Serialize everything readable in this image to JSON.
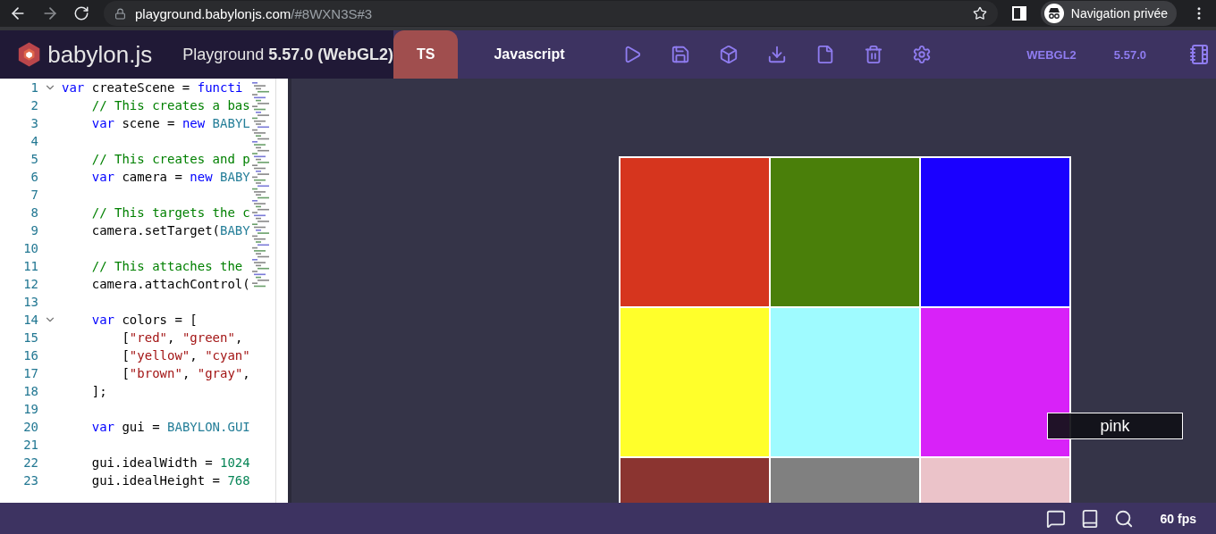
{
  "browser": {
    "url_host": "playground.babylonjs.com",
    "url_path": "/#8WXN3S#3",
    "profile_label": "Navigation privée"
  },
  "header": {
    "logo_text": "babylon.js",
    "title": "Playground **5.57.0 (WebGL2)**",
    "tabs": [
      {
        "label": "TS",
        "selected": true
      },
      {
        "label": "Javascript",
        "selected": false
      }
    ],
    "engine": "WEBGL2",
    "version": "5.57.0"
  },
  "editor": {
    "lines": [
      {
        "number": "1",
        "foldable": true,
        "segments": [
          {
            "kind": "keyword",
            "text": "var"
          },
          {
            "kind": "plain",
            "text": " createScene = "
          },
          {
            "kind": "keyword",
            "text": "functi"
          }
        ]
      },
      {
        "number": "2",
        "foldable": false,
        "segments": [
          {
            "kind": "comment",
            "text": "    // This creates a bas"
          }
        ]
      },
      {
        "number": "3",
        "foldable": false,
        "segments": [
          {
            "kind": "keyword",
            "text": "    var"
          },
          {
            "kind": "plain",
            "text": " scene = "
          },
          {
            "kind": "keyword",
            "text": "new"
          },
          {
            "kind": "ident",
            "text": " BABYL"
          }
        ]
      },
      {
        "number": "4",
        "foldable": false
      },
      {
        "number": "5",
        "foldable": false,
        "segments": [
          {
            "kind": "comment",
            "text": "    // This creates and p"
          }
        ]
      },
      {
        "number": "6",
        "foldable": false,
        "segments": [
          {
            "kind": "keyword",
            "text": "    var"
          },
          {
            "kind": "plain",
            "text": " camera = "
          },
          {
            "kind": "keyword",
            "text": "new"
          },
          {
            "kind": "ident",
            "text": " BABY"
          }
        ]
      },
      {
        "number": "7",
        "foldable": false
      },
      {
        "number": "8",
        "foldable": false,
        "segments": [
          {
            "kind": "comment",
            "text": "    // This targets the c"
          }
        ]
      },
      {
        "number": "9",
        "foldable": false,
        "segments": [
          {
            "kind": "plain",
            "text": "    camera.setTarget("
          },
          {
            "kind": "ident",
            "text": "BABY"
          }
        ]
      },
      {
        "number": "10",
        "foldable": false
      },
      {
        "number": "11",
        "foldable": false,
        "segments": [
          {
            "kind": "comment",
            "text": "    // This attaches the"
          }
        ]
      },
      {
        "number": "12",
        "foldable": false,
        "segments": [
          {
            "kind": "plain",
            "text": "    camera.attachControl("
          }
        ]
      },
      {
        "number": "13",
        "foldable": false
      },
      {
        "number": "14",
        "foldable": true,
        "segments": [
          {
            "kind": "keyword",
            "text": "    var"
          },
          {
            "kind": "plain",
            "text": " colors = ["
          }
        ]
      },
      {
        "number": "15",
        "foldable": false,
        "segments": [
          {
            "kind": "plain",
            "text": "        ["
          },
          {
            "kind": "string",
            "text": "\"red\""
          },
          {
            "kind": "plain",
            "text": ", "
          },
          {
            "kind": "string",
            "text": "\"green\""
          },
          {
            "kind": "plain",
            "text": ","
          }
        ]
      },
      {
        "number": "16",
        "foldable": false,
        "segments": [
          {
            "kind": "plain",
            "text": "        ["
          },
          {
            "kind": "string",
            "text": "\"yellow\""
          },
          {
            "kind": "plain",
            "text": ", "
          },
          {
            "kind": "string",
            "text": "\"cyan\""
          }
        ]
      },
      {
        "number": "17",
        "foldable": false,
        "segments": [
          {
            "kind": "plain",
            "text": "        ["
          },
          {
            "kind": "string",
            "text": "\"brown\""
          },
          {
            "kind": "plain",
            "text": ", "
          },
          {
            "kind": "string",
            "text": "\"gray\""
          },
          {
            "kind": "plain",
            "text": ","
          }
        ]
      },
      {
        "number": "18",
        "foldable": false,
        "segments": [
          {
            "kind": "plain",
            "text": "    ];"
          }
        ]
      },
      {
        "number": "19",
        "foldable": false
      },
      {
        "number": "20",
        "foldable": false,
        "segments": [
          {
            "kind": "keyword",
            "text": "    var"
          },
          {
            "kind": "plain",
            "text": " gui = "
          },
          {
            "kind": "ident",
            "text": "BABYLON.GUI"
          }
        ]
      },
      {
        "number": "21",
        "foldable": false
      },
      {
        "number": "22",
        "foldable": false,
        "segments": [
          {
            "kind": "plain",
            "text": "    gui.idealWidth = "
          },
          {
            "kind": "number",
            "text": "1024"
          }
        ]
      },
      {
        "number": "23",
        "foldable": false,
        "segments": [
          {
            "kind": "plain",
            "text": "    gui.idealHeight = "
          },
          {
            "kind": "number",
            "text": "768"
          }
        ]
      }
    ]
  },
  "scene": {
    "tiles": [
      {
        "color": "#d6351e"
      },
      {
        "color": "#4a7f0a"
      },
      {
        "color": "#1a00ff"
      },
      {
        "color": "#ffff2b"
      },
      {
        "color": "#9ffbff"
      },
      {
        "color": "#d822f8"
      },
      {
        "color": "#8b3430"
      },
      {
        "color": "#808080"
      },
      {
        "color": "#ebc3c9"
      }
    ],
    "hover_label": "pink"
  },
  "footer": {
    "fps": "60 fps"
  }
}
